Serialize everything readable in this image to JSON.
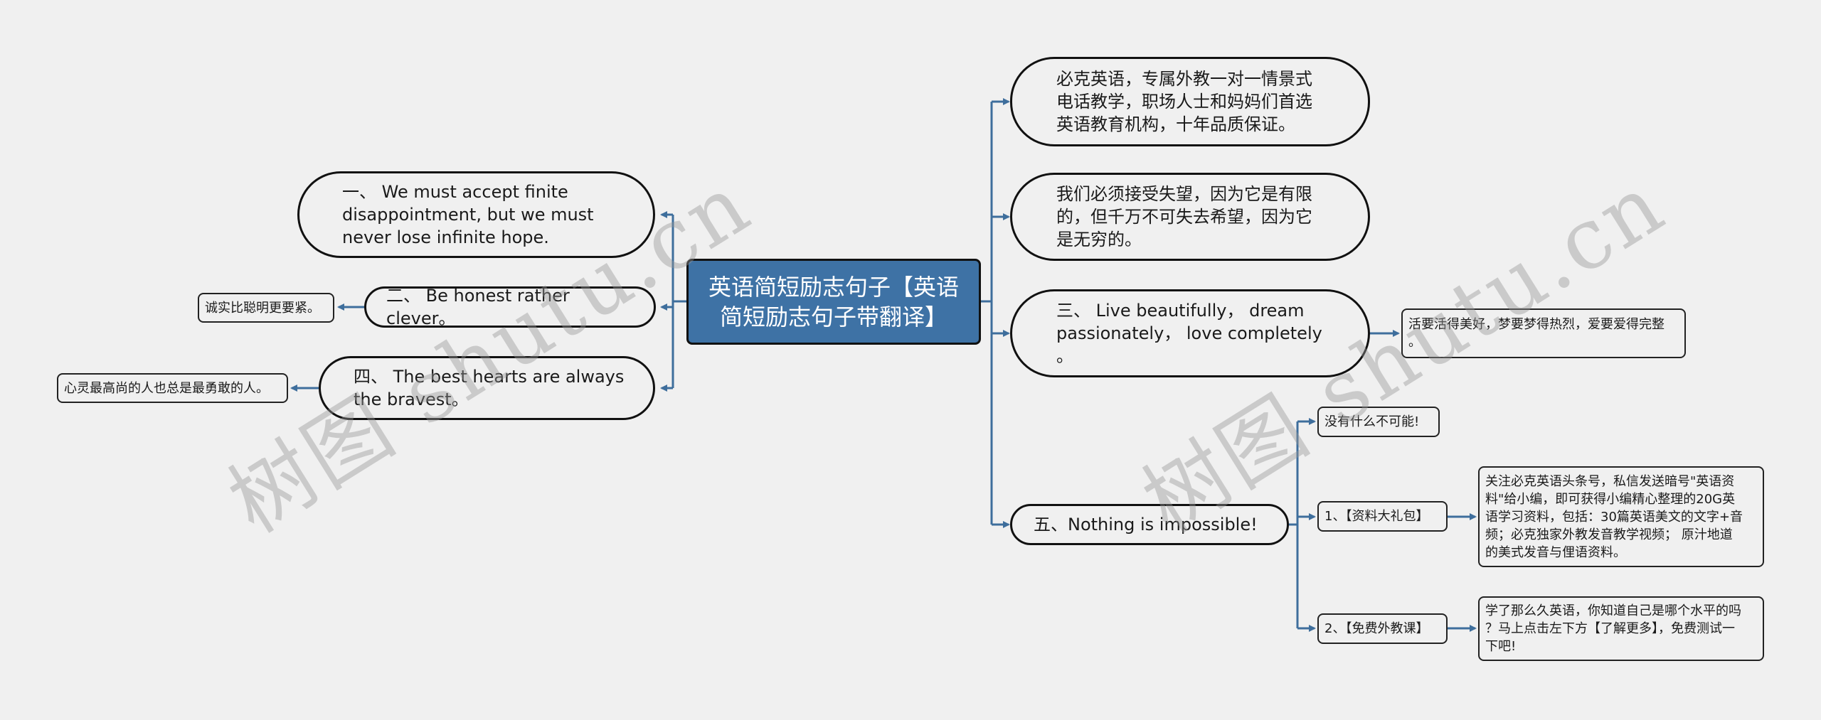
{
  "colors": {
    "background": "#f0f0f0",
    "root_fill": "#3e72a5",
    "connector": "#3e6e9c",
    "border": "#111111"
  },
  "root": {
    "label": "英语简短励志句子【英语简短励志句子带翻译】"
  },
  "left_branches": [
    {
      "label": "一、 We must accept finite\ndisappointment, but we must\nnever lose infinite hope.",
      "children": []
    },
    {
      "label": "二、 Be honest rather clever。",
      "children": [
        {
          "label": "诚实比聪明更要紧。"
        }
      ]
    },
    {
      "label": "四、 The best hearts are always\nthe bravest。",
      "children": [
        {
          "label": "心灵最高尚的人也总是最勇敢的人。"
        }
      ]
    }
  ],
  "right_branches": [
    {
      "label": "必克英语，专属外教一对一情景式\n电话教学，职场人士和妈妈们首选\n英语教育机构，十年品质保证。",
      "children": []
    },
    {
      "label": "我们必须接受失望，因为它是有限\n的，但千万不可失去希望，因为它\n是无穷的。",
      "children": []
    },
    {
      "label": "三、 Live beautifully，  dream\npassionately，  love completely\n。",
      "children": [
        {
          "label": "活要活得美好，梦要梦得热烈，爱要爱得完整\n。"
        }
      ]
    },
    {
      "label": "五、Nothing is impossible!",
      "children": [
        {
          "label": "没有什么不可能!",
          "children": []
        },
        {
          "label": "1、【资料大礼包】",
          "children": [
            {
              "label": "关注必克英语头条号，私信发送暗号\"英语资\n料\"给小编，即可获得小编精心整理的20G英\n语学习资料，包括：30篇英语美文的文字+音\n频；必克独家外教发音教学视频； 原汁地道\n的美式发音与俚语资料。"
            }
          ]
        },
        {
          "label": "2、【免费外教课】",
          "children": [
            {
              "label": "学了那么久英语，你知道自己是哪个水平的吗\n？马上点击左下方【了解更多】，免费测试一\n下吧!"
            }
          ]
        }
      ]
    }
  ],
  "watermarks": [
    "树图 shutu.cn",
    "树图 shutu.cn"
  ]
}
